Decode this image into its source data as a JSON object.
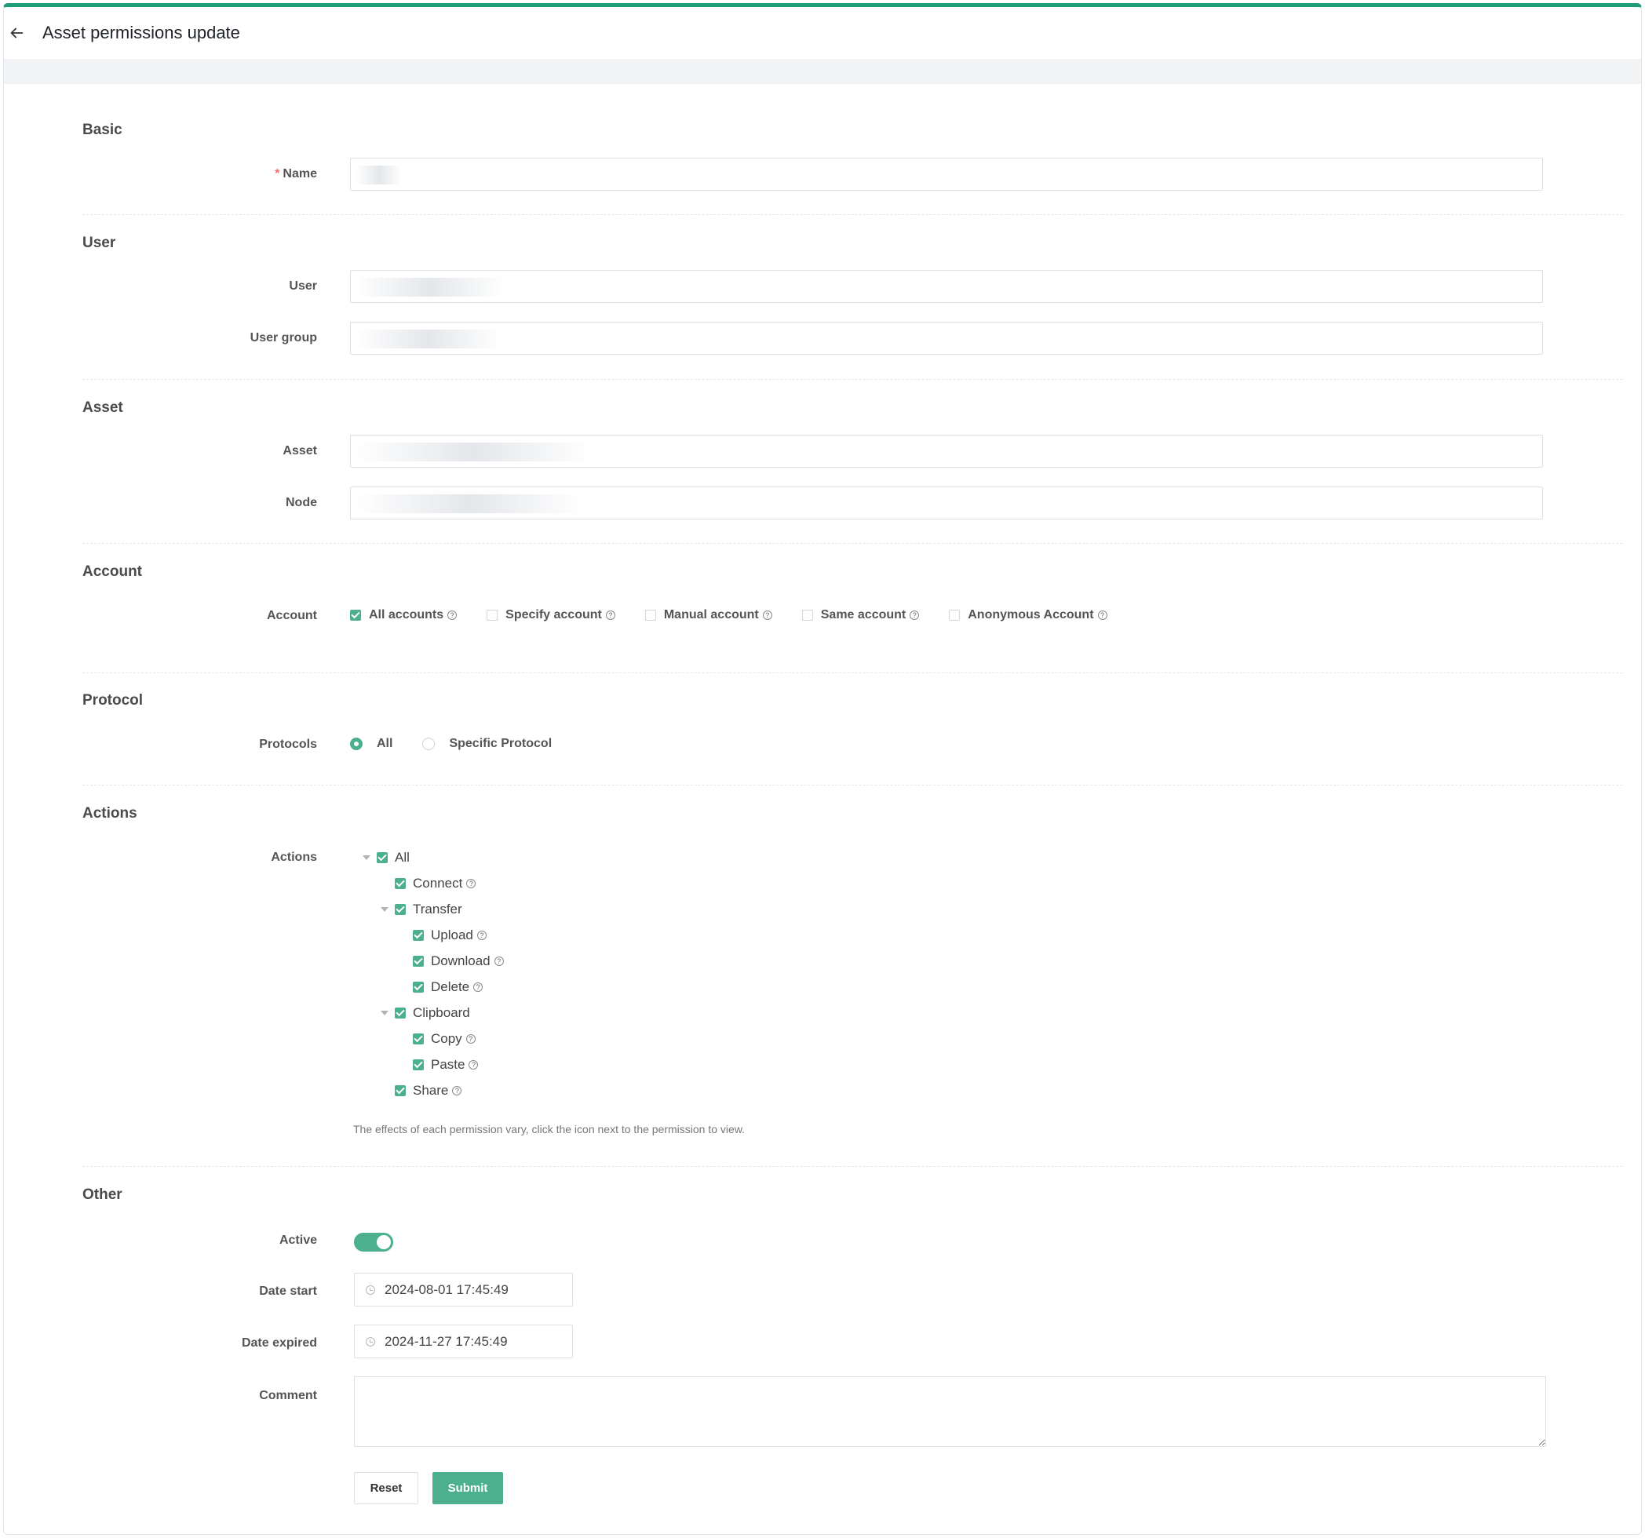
{
  "header": {
    "title": "Asset permissions update"
  },
  "sections": {
    "basic": "Basic",
    "user": "User",
    "asset": "Asset",
    "account": "Account",
    "protocol": "Protocol",
    "actions": "Actions",
    "other": "Other"
  },
  "fields": {
    "name": {
      "label": "Name",
      "required_mark": "*",
      "value": ""
    },
    "user": {
      "label": "User",
      "value": ""
    },
    "user_group": {
      "label": "User group",
      "value": ""
    },
    "asset": {
      "label": "Asset",
      "value": ""
    },
    "node": {
      "label": "Node",
      "value": ""
    },
    "account": {
      "label": "Account",
      "options": [
        {
          "label": "All accounts",
          "checked": true
        },
        {
          "label": "Specify account",
          "checked": false
        },
        {
          "label": "Manual account",
          "checked": false
        },
        {
          "label": "Same account",
          "checked": false
        },
        {
          "label": "Anonymous Account",
          "checked": false
        }
      ]
    },
    "protocols": {
      "label": "Protocols",
      "options": [
        {
          "label": "All",
          "selected": true
        },
        {
          "label": "Specific Protocol",
          "selected": false
        }
      ]
    },
    "actions": {
      "label": "Actions",
      "tree": {
        "all": "All",
        "connect": "Connect",
        "transfer": "Transfer",
        "upload": "Upload",
        "download": "Download",
        "delete": "Delete",
        "clipboard": "Clipboard",
        "copy": "Copy",
        "paste": "Paste",
        "share": "Share"
      },
      "hint": "The effects of each permission vary, click the icon next to the permission to view."
    },
    "active": {
      "label": "Active",
      "on": true
    },
    "date_start": {
      "label": "Date start",
      "value": "2024-08-01 17:45:49"
    },
    "date_expired": {
      "label": "Date expired",
      "value": "2024-11-27 17:45:49"
    },
    "comment": {
      "label": "Comment",
      "value": ""
    }
  },
  "buttons": {
    "reset": "Reset",
    "submit": "Submit"
  },
  "colors": {
    "accent": "#4caf8e",
    "top_border": "#1f9d7a",
    "required": "#f56c6c"
  }
}
